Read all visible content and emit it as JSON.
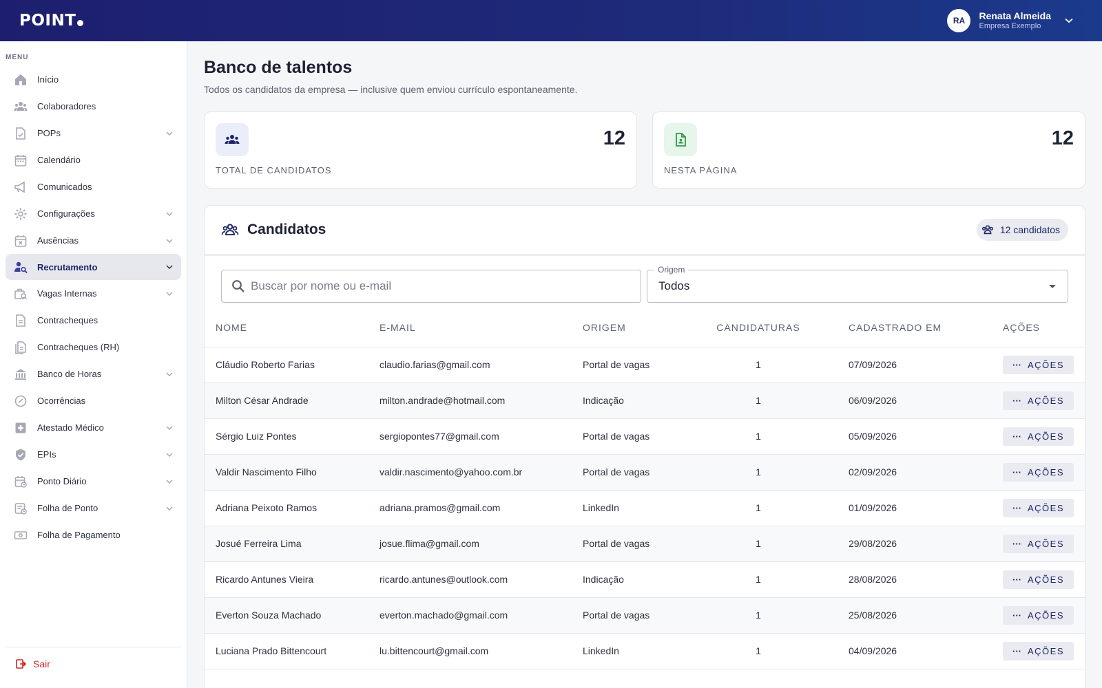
{
  "header": {
    "logo": "POINT",
    "user": {
      "initials": "RA",
      "name": "Renata Almeida",
      "company": "Empresa Exemplo"
    }
  },
  "sidebar": {
    "menu_label": "MENU",
    "items": [
      {
        "label": "Início",
        "icon": "home-icon",
        "chevron": false
      },
      {
        "label": "Colaboradores",
        "icon": "people-icon",
        "chevron": false
      },
      {
        "label": "POPs",
        "icon": "document-check-icon",
        "chevron": true
      },
      {
        "label": "Calendário",
        "icon": "calendar-icon",
        "chevron": false
      },
      {
        "label": "Comunicados",
        "icon": "megaphone-icon",
        "chevron": false
      },
      {
        "label": "Configurações",
        "icon": "gear-icon",
        "chevron": true
      },
      {
        "label": "Ausências",
        "icon": "calendar-x-icon",
        "chevron": true
      },
      {
        "label": "Recrutamento",
        "icon": "person-search-icon",
        "chevron": true,
        "active": true
      },
      {
        "label": "Vagas Internas",
        "icon": "work-search-icon",
        "chevron": true
      },
      {
        "label": "Contracheques",
        "icon": "receipt-icon",
        "chevron": false
      },
      {
        "label": "Contracheques (RH)",
        "icon": "receipt-stack-icon",
        "chevron": false
      },
      {
        "label": "Banco de Horas",
        "icon": "bank-icon",
        "chevron": true
      },
      {
        "label": "Ocorrências",
        "icon": "incident-icon",
        "chevron": false
      },
      {
        "label": "Atestado Médico",
        "icon": "medical-icon",
        "chevron": true
      },
      {
        "label": "EPIs",
        "icon": "shield-check-icon",
        "chevron": true
      },
      {
        "label": "Ponto Diário",
        "icon": "calendar-clock-icon",
        "chevron": true
      },
      {
        "label": "Folha de Ponto",
        "icon": "timesheet-icon",
        "chevron": true
      },
      {
        "label": "Folha de Pagamento",
        "icon": "payroll-icon",
        "chevron": false
      }
    ],
    "logout_label": "Sair"
  },
  "main": {
    "title": "Banco de talentos",
    "subtitle": "Todos os candidatos da empresa — inclusive quem enviou currículo espontaneamente.",
    "cards": [
      {
        "value": "12",
        "label": "TOTAL DE CANDIDATOS",
        "icon": "group-icon"
      },
      {
        "value": "12",
        "label": "NESTA PÁGINA",
        "icon": "document-person-icon"
      }
    ],
    "panel": {
      "title": "Candidatos",
      "count_pill": "12 candidatos",
      "search_placeholder": "Buscar por nome ou e-mail",
      "origin_label": "Origem",
      "origin_value": "Todos",
      "columns": [
        "NOME",
        "E-MAIL",
        "ORIGEM",
        "CANDIDATURAS",
        "CADASTRADO EM",
        "AÇÕES"
      ],
      "action_label": "AÇÕES",
      "rows": [
        {
          "name": "Cláudio Roberto Farias",
          "email": "claudio.farias@gmail.com",
          "origin": "Portal de vagas",
          "applications": "1",
          "date": "07/09/2026"
        },
        {
          "name": "Milton César Andrade",
          "email": "milton.andrade@hotmail.com",
          "origin": "Indicação",
          "applications": "1",
          "date": "06/09/2026"
        },
        {
          "name": "Sérgio Luiz Pontes",
          "email": "sergiopontes77@gmail.com",
          "origin": "Portal de vagas",
          "applications": "1",
          "date": "05/09/2026"
        },
        {
          "name": "Valdir Nascimento Filho",
          "email": "valdir.nascimento@yahoo.com.br",
          "origin": "Portal de vagas",
          "applications": "1",
          "date": "02/09/2026"
        },
        {
          "name": "Adriana Peixoto Ramos",
          "email": "adriana.pramos@gmail.com",
          "origin": "LinkedIn",
          "applications": "1",
          "date": "01/09/2026"
        },
        {
          "name": "Josué Ferreira Lima",
          "email": "josue.flima@gmail.com",
          "origin": "Portal de vagas",
          "applications": "1",
          "date": "29/08/2026"
        },
        {
          "name": "Ricardo Antunes Vieira",
          "email": "ricardo.antunes@outlook.com",
          "origin": "Indicação",
          "applications": "1",
          "date": "28/08/2026"
        },
        {
          "name": "Everton Souza Machado",
          "email": "everton.machado@gmail.com",
          "origin": "Portal de vagas",
          "applications": "1",
          "date": "25/08/2026"
        },
        {
          "name": "Luciana Prado Bittencourt",
          "email": "lu.bittencourt@gmail.com",
          "origin": "LinkedIn",
          "applications": "1",
          "date": "04/09/2026"
        }
      ]
    }
  }
}
